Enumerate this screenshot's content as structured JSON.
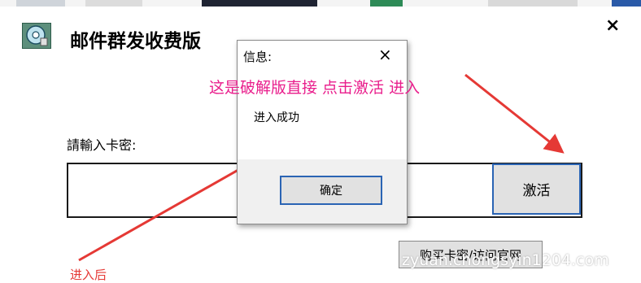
{
  "app": {
    "title": "邮件群发收费版",
    "app_icon": "disc-icon",
    "close_glyph": "×"
  },
  "form": {
    "card_label": "請輸入卡密:",
    "card_value": "",
    "activate_label": "激活",
    "buy_label": "购买卡密/访问官网"
  },
  "dialog": {
    "title": "信息:",
    "message": "进入成功",
    "ok_label": "确定",
    "close_glyph": "×"
  },
  "annotation": {
    "text": "这是破解版直接 点击激活 进入",
    "color": "#e91e8c",
    "arrow_color": "#e53935"
  },
  "bottom_text": "进入后",
  "watermark": "zyuan.chongsyin1204.com"
}
